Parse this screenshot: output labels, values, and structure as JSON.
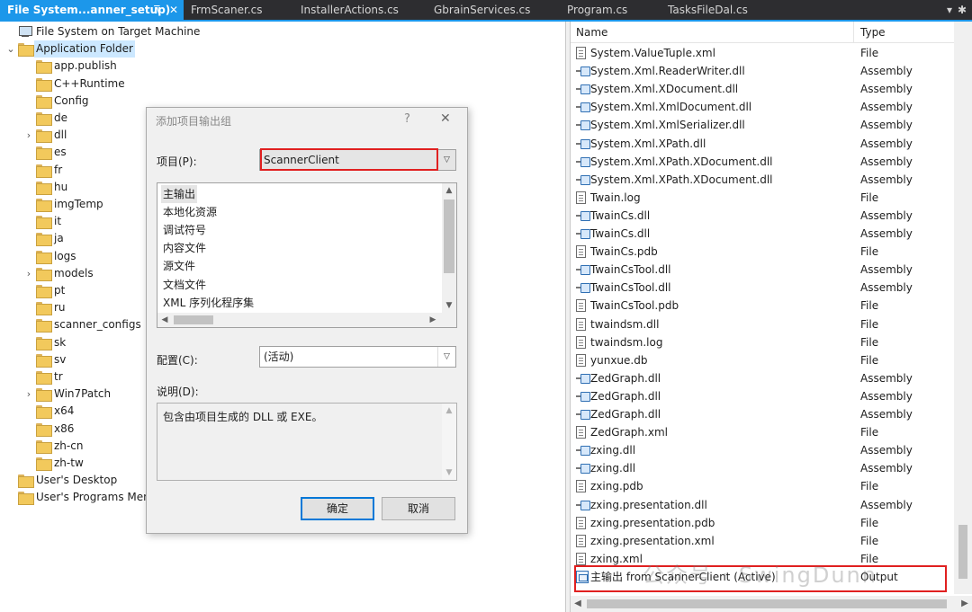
{
  "tabs": [
    {
      "label": "File System...anner_setup)",
      "active": true
    },
    {
      "label": "FrmScaner.cs",
      "active": false
    },
    {
      "label": "InstallerActions.cs",
      "active": false
    },
    {
      "label": "GbrainServices.cs",
      "active": false
    },
    {
      "label": "Program.cs",
      "active": false
    },
    {
      "label": "TasksFileDal.cs",
      "active": false
    }
  ],
  "tab_icons": {
    "pin": "⊼",
    "close": "✕",
    "overflow": "▾",
    "settings": "✱"
  },
  "tree": {
    "root": "File System on Target Machine",
    "app_folder": "Application Folder",
    "children": [
      "app.publish",
      "C++Runtime",
      "Config",
      "de",
      "dll",
      "es",
      "fr",
      "hu",
      "imgTemp",
      "it",
      "ja",
      "logs",
      "models",
      "pt",
      "ru",
      "scanner_configs",
      "sk",
      "sv",
      "tr",
      "Win7Patch",
      "x64",
      "x86",
      "zh-cn",
      "zh-tw"
    ],
    "expandable": [
      "dll",
      "models",
      "Win7Patch"
    ],
    "user_desktop": "User's Desktop",
    "user_programs": "User's Programs Menu"
  },
  "list": {
    "columns": {
      "name": "Name",
      "type": "Type"
    },
    "rows": [
      {
        "name": "System.ValueTuple.xml",
        "type": "File",
        "icon": "file"
      },
      {
        "name": "System.Xml.ReaderWriter.dll",
        "type": "Assembly",
        "icon": "assembly"
      },
      {
        "name": "System.Xml.XDocument.dll",
        "type": "Assembly",
        "icon": "assembly"
      },
      {
        "name": "System.Xml.XmlDocument.dll",
        "type": "Assembly",
        "icon": "assembly"
      },
      {
        "name": "System.Xml.XmlSerializer.dll",
        "type": "Assembly",
        "icon": "assembly"
      },
      {
        "name": "System.Xml.XPath.dll",
        "type": "Assembly",
        "icon": "assembly"
      },
      {
        "name": "System.Xml.XPath.XDocument.dll",
        "type": "Assembly",
        "icon": "assembly"
      },
      {
        "name": "System.Xml.XPath.XDocument.dll",
        "type": "Assembly",
        "icon": "assembly"
      },
      {
        "name": "Twain.log",
        "type": "File",
        "icon": "file"
      },
      {
        "name": "TwainCs.dll",
        "type": "Assembly",
        "icon": "assembly"
      },
      {
        "name": "TwainCs.dll",
        "type": "Assembly",
        "icon": "assembly"
      },
      {
        "name": "TwainCs.pdb",
        "type": "File",
        "icon": "file"
      },
      {
        "name": "TwainCsTool.dll",
        "type": "Assembly",
        "icon": "assembly"
      },
      {
        "name": "TwainCsTool.dll",
        "type": "Assembly",
        "icon": "assembly"
      },
      {
        "name": "TwainCsTool.pdb",
        "type": "File",
        "icon": "file"
      },
      {
        "name": "twaindsm.dll",
        "type": "File",
        "icon": "file"
      },
      {
        "name": "twaindsm.log",
        "type": "File",
        "icon": "file"
      },
      {
        "name": "yunxue.db",
        "type": "File",
        "icon": "file"
      },
      {
        "name": "ZedGraph.dll",
        "type": "Assembly",
        "icon": "assembly"
      },
      {
        "name": "ZedGraph.dll",
        "type": "Assembly",
        "icon": "assembly"
      },
      {
        "name": "ZedGraph.dll",
        "type": "Assembly",
        "icon": "assembly"
      },
      {
        "name": "ZedGraph.xml",
        "type": "File",
        "icon": "file"
      },
      {
        "name": "zxing.dll",
        "type": "Assembly",
        "icon": "assembly"
      },
      {
        "name": "zxing.dll",
        "type": "Assembly",
        "icon": "assembly"
      },
      {
        "name": "zxing.pdb",
        "type": "File",
        "icon": "file"
      },
      {
        "name": "zxing.presentation.dll",
        "type": "Assembly",
        "icon": "assembly"
      },
      {
        "name": "zxing.presentation.pdb",
        "type": "File",
        "icon": "file"
      },
      {
        "name": "zxing.presentation.xml",
        "type": "File",
        "icon": "file"
      },
      {
        "name": "zxing.xml",
        "type": "File",
        "icon": "file"
      },
      {
        "name": "主输出 from ScannerClient (Active)",
        "type": "Output",
        "icon": "output"
      }
    ]
  },
  "watermark": "公众号 · SwingDunn",
  "dialog": {
    "title": "添加项目输出组",
    "help": "?",
    "close": "✕",
    "project_label": "项目(P):",
    "project_value": "ScannerClient",
    "outputs": [
      "主输出",
      "本地化资源",
      "调试符号",
      "内容文件",
      "源文件",
      "文档文件",
      "XML 序列化程序集"
    ],
    "config_label": "配置(C):",
    "config_value": "(活动)",
    "desc_label": "说明(D):",
    "desc_text": "包含由项目生成的 DLL 或 EXE。",
    "ok": "确定",
    "cancel": "取消"
  }
}
